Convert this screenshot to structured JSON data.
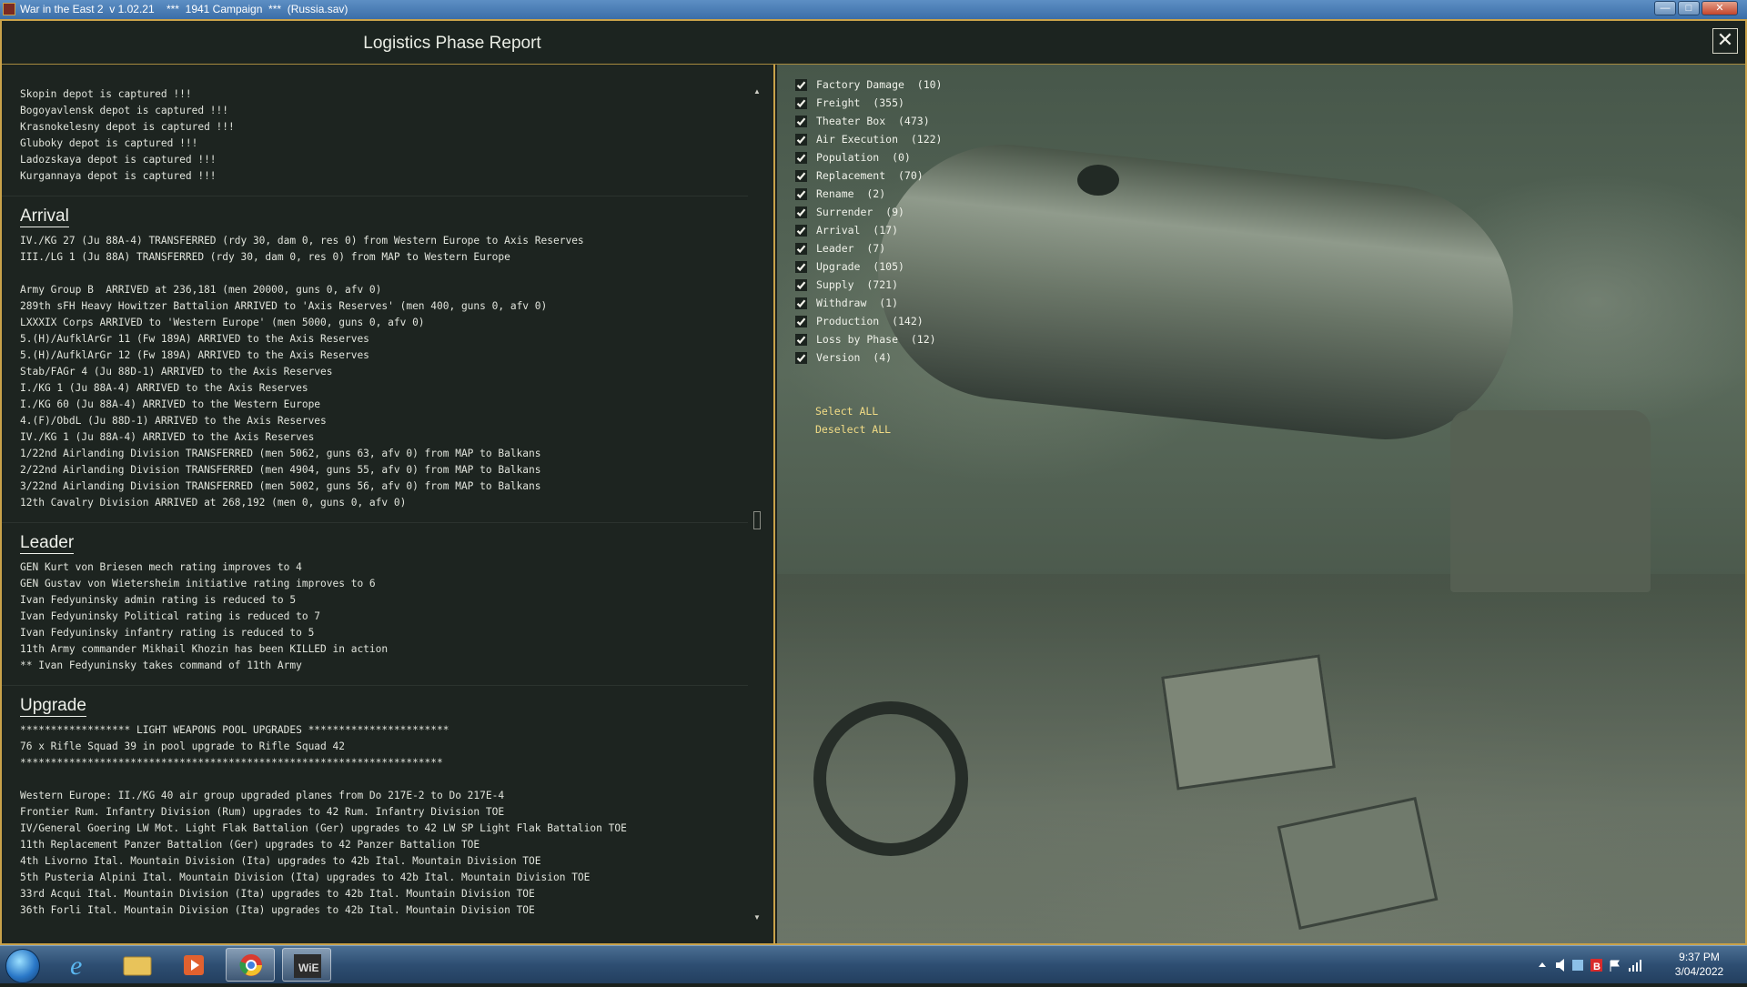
{
  "titlebar": {
    "title": "War in the East 2  v 1.02.21    ***  1941 Campaign  ***  (Russia.sav)",
    "minimize": "—",
    "maximize": "□",
    "close": "✕"
  },
  "dialog": {
    "title": "Logistics Phase Report",
    "close_icon": "✕"
  },
  "report": {
    "depots": [
      "Skopin depot is captured !!!",
      "Bogoyavlensk depot is captured !!!",
      "Krasnokelesny depot is captured !!!",
      "Gluboky depot is captured !!!",
      "Ladozskaya depot is captured !!!",
      "Kurgannaya depot is captured !!!"
    ],
    "arrival": {
      "heading": "Arrival",
      "lines": [
        "IV./KG 27 (Ju 88A-4) TRANSFERRED (rdy 30, dam 0, res 0) from Western Europe to Axis Reserves",
        "III./LG 1 (Ju 88A) TRANSFERRED (rdy 30, dam 0, res 0) from MAP to Western Europe",
        "",
        "Army Group B  ARRIVED at 236,181 (men 20000, guns 0, afv 0)",
        "289th sFH Heavy Howitzer Battalion ARRIVED to 'Axis Reserves' (men 400, guns 0, afv 0)",
        "LXXXIX Corps ARRIVED to 'Western Europe' (men 5000, guns 0, afv 0)",
        "5.(H)/AufklArGr 11 (Fw 189A) ARRIVED to the Axis Reserves",
        "5.(H)/AufklArGr 12 (Fw 189A) ARRIVED to the Axis Reserves",
        "Stab/FAGr 4 (Ju 88D-1) ARRIVED to the Axis Reserves",
        "I./KG 1 (Ju 88A-4) ARRIVED to the Axis Reserves",
        "I./KG 60 (Ju 88A-4) ARRIVED to the Western Europe",
        "4.(F)/ObdL (Ju 88D-1) ARRIVED to the Axis Reserves",
        "IV./KG 1 (Ju 88A-4) ARRIVED to the Axis Reserves",
        "1/22nd Airlanding Division TRANSFERRED (men 5062, guns 63, afv 0) from MAP to Balkans",
        "2/22nd Airlanding Division TRANSFERRED (men 4904, guns 55, afv 0) from MAP to Balkans",
        "3/22nd Airlanding Division TRANSFERRED (men 5002, guns 56, afv 0) from MAP to Balkans",
        "12th Cavalry Division ARRIVED at 268,192 (men 0, guns 0, afv 0)"
      ]
    },
    "leader": {
      "heading": "Leader",
      "lines": [
        "GEN Kurt von Briesen mech rating improves to 4",
        "GEN Gustav von Wietersheim initiative rating improves to 6",
        "Ivan Fedyuninsky admin rating is reduced to 5",
        "Ivan Fedyuninsky Political rating is reduced to 7",
        "Ivan Fedyuninsky infantry rating is reduced to 5",
        "11th Army commander Mikhail Khozin has been KILLED in action",
        "** Ivan Fedyuninsky takes command of 11th Army"
      ]
    },
    "upgrade": {
      "heading": "Upgrade",
      "lines": [
        "****************** LIGHT WEAPONS POOL UPGRADES ***********************",
        "76 x Rifle Squad 39 in pool upgrade to Rifle Squad 42",
        "*********************************************************************",
        "",
        "Western Europe: II./KG 40 air group upgraded planes from Do 217E-2 to Do 217E-4",
        "Frontier Rum. Infantry Division (Rum) upgrades to 42 Rum. Infantry Division TOE",
        "IV/General Goering LW Mot. Light Flak Battalion (Ger) upgrades to 42 LW SP Light Flak Battalion TOE",
        "11th Replacement Panzer Battalion (Ger) upgrades to 42 Panzer Battalion TOE",
        "4th Livorno Ital. Mountain Division (Ita) upgrades to 42b Ital. Mountain Division TOE",
        "5th Pusteria Alpini Ital. Mountain Division (Ita) upgrades to 42b Ital. Mountain Division TOE",
        "33rd Acqui Ital. Mountain Division (Ita) upgrades to 42b Ital. Mountain Division TOE",
        "36th Forli Ital. Mountain Division (Ita) upgrades to 42b Ital. Mountain Division TOE"
      ]
    }
  },
  "filters": [
    {
      "label": "Factory Damage  (10)",
      "checked": true
    },
    {
      "label": "Freight  (355)",
      "checked": true
    },
    {
      "label": "Theater Box  (473)",
      "checked": true
    },
    {
      "label": "Air Execution  (122)",
      "checked": true
    },
    {
      "label": "Population  (0)",
      "checked": true
    },
    {
      "label": "Replacement  (70)",
      "checked": true
    },
    {
      "label": "Rename  (2)",
      "checked": true
    },
    {
      "label": "Surrender  (9)",
      "checked": true
    },
    {
      "label": "Arrival  (17)",
      "checked": true
    },
    {
      "label": "Leader  (7)",
      "checked": true
    },
    {
      "label": "Upgrade  (105)",
      "checked": true
    },
    {
      "label": "Supply  (721)",
      "checked": true
    },
    {
      "label": "Withdraw  (1)",
      "checked": true
    },
    {
      "label": "Production  (142)",
      "checked": true
    },
    {
      "label": "Loss by Phase  (12)",
      "checked": true
    },
    {
      "label": "Version  (4)",
      "checked": true
    }
  ],
  "select_all": "Select ALL",
  "deselect_all": "Deselect ALL",
  "taskbar": {
    "apps": [
      "start-orb",
      "internet-explorer-icon",
      "file-explorer-icon",
      "media-player-icon",
      "chrome-icon",
      "war-in-the-east-icon"
    ],
    "clock_time": "9:37 PM",
    "clock_date": "3/04/2022"
  },
  "colors": {
    "accent_gold": "#c9a24a",
    "link_yellow": "#f2dc86",
    "panel_bg": "#1d2420"
  }
}
